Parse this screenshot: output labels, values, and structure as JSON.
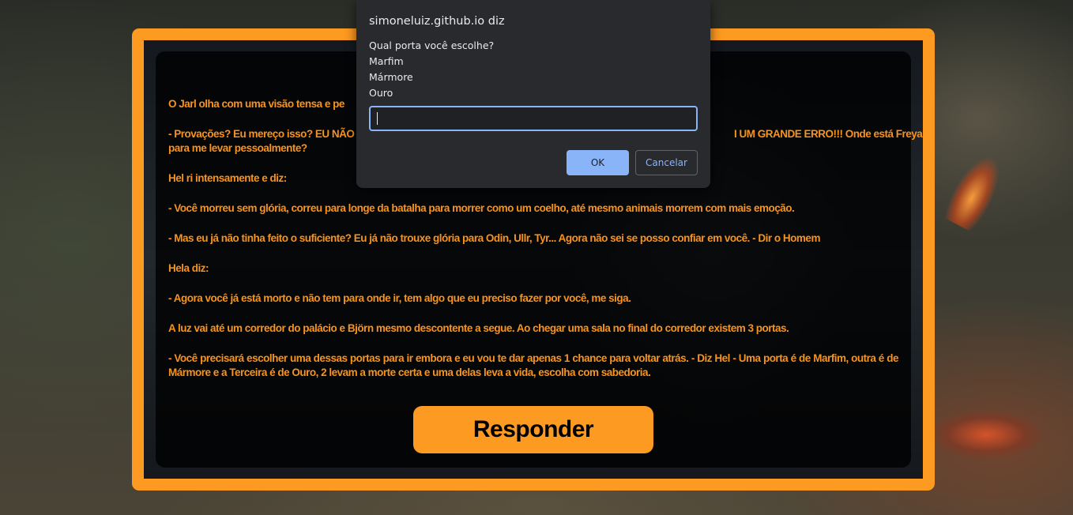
{
  "page": {
    "accent_color": "#fd9a21",
    "text_color": "#f7931e"
  },
  "story": {
    "paragraphs": [
      "O Jarl olha com uma visão tensa e pe",
      "- Provações? Eu mereço isso? EU NÃO",
      "para me levar pessoalmente?",
      "Hel ri intensamente e diz:",
      "- Você morreu sem glória, correu para longe da batalha para morrer como um coelho, até mesmo animais morrem com mais emoção.",
      "- Mas eu já não tinha feito o suficiente? Eu já não trouxe glória para Odin, Ullr, Tyr... Agora não sei se posso confiar em você. - Dir o Homem",
      "Hela diz:",
      "- Agora você já está morto e não tem para onde ir, tem algo que eu preciso fazer por você, me siga.",
      "A luz vai até um corredor do palácio e Björn mesmo descontente a segue. Ao chegar uma sala no final do corredor existem 3 portas.",
      "- Você precisará escolher uma dessas portas para ir embora e eu vou te dar apenas 1 chance para voltar atrás. - Diz Hel - Uma porta é de Marfim, outra é de Mármore e a Terceira é de Ouro, 2 levam a morte certa e uma delas leva a vida, escolha com sabedoria."
    ],
    "line2_visible_end": "I UM GRANDE ERRO!!! Onde está Freya",
    "respond_button": "Responder"
  },
  "dialog": {
    "title": "simoneluiz.github.io diz",
    "message_lines": [
      "Qual porta você escolhe?",
      "Marfim",
      "Mármore",
      "Ouro"
    ],
    "input_value": "",
    "ok_label": "OK",
    "cancel_label": "Cancelar"
  }
}
